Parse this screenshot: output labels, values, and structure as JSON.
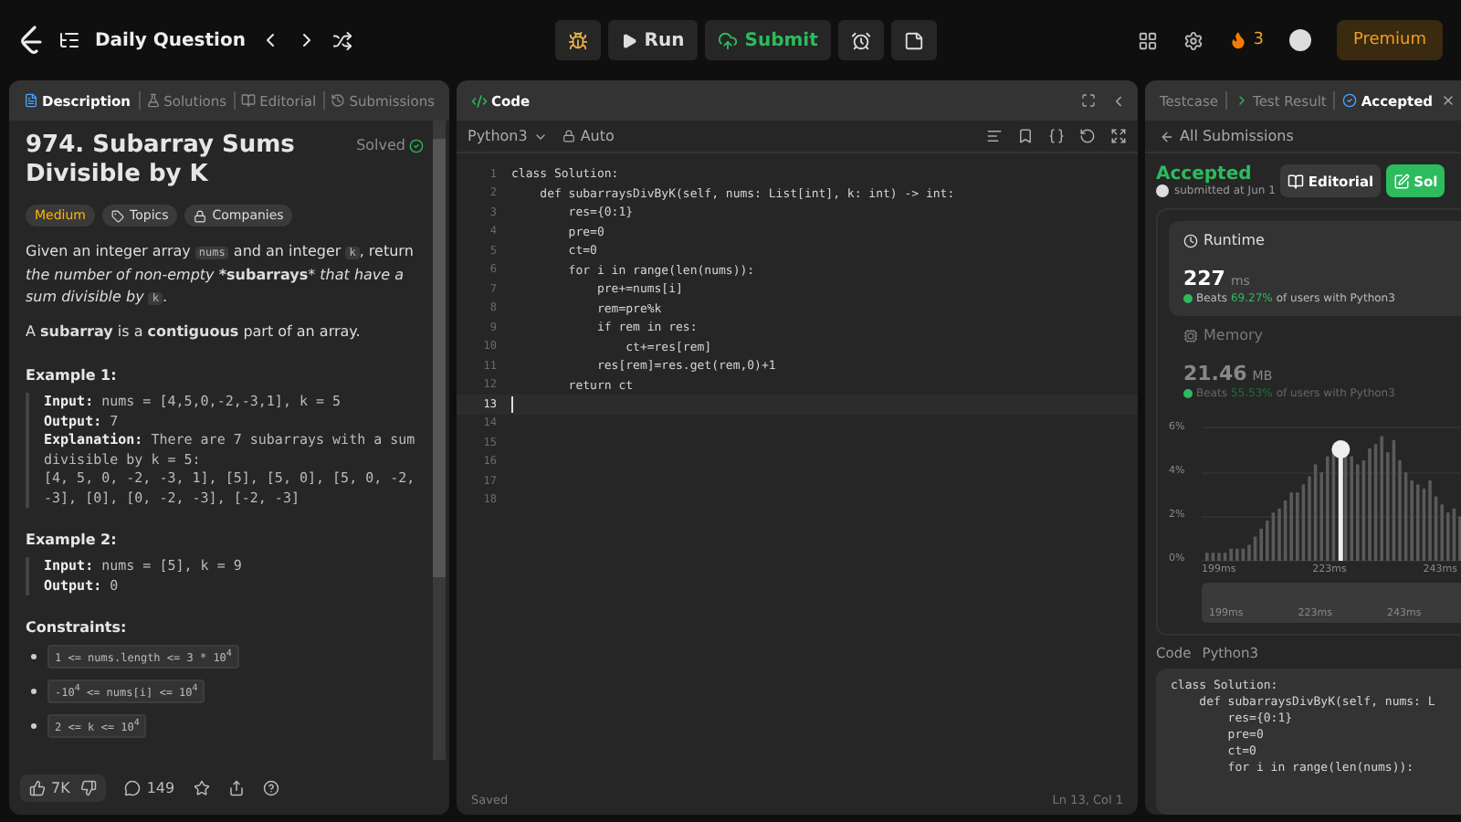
{
  "top_bar": {
    "title": "Daily Question",
    "run": "Run",
    "submit": "Submit",
    "streak": "3",
    "premium": "Premium"
  },
  "description_panel": {
    "tabs": [
      {
        "label": "Description",
        "selected": true
      },
      {
        "label": "Solutions",
        "selected": false
      },
      {
        "label": "Editorial",
        "selected": false
      },
      {
        "label": "Submissions",
        "selected": false
      }
    ],
    "title": "974. Subarray Sums Divisible by K",
    "status": "Solved",
    "difficulty": "Medium",
    "tags": [
      "Topics",
      "Companies"
    ],
    "paragraphs": [
      [
        {
          "kind": "text",
          "text": "Given an integer array "
        },
        {
          "kind": "code",
          "text": "nums"
        },
        {
          "kind": "text",
          "text": " and an integer "
        },
        {
          "kind": "code",
          "text": "k"
        },
        {
          "kind": "text",
          "text": ", return *the number of non-empty* ***subarrays*** *that have a sum divisible by* "
        },
        {
          "kind": "code",
          "text": "k"
        },
        {
          "kind": "text",
          "text": "."
        }
      ],
      [
        {
          "kind": "text",
          "text": "A **subarray** is a **contiguous** part of an array."
        }
      ]
    ],
    "examples": [
      {
        "title": "Example 1:",
        "lines": [
          "**Input:** nums = [4,5,0,-2,-3,1], k = 5",
          "**Output:** 7",
          "**Explanation:** There are 7 subarrays with a sum divisible by k = 5:",
          "[4, 5, 0, -2, -3, 1], [5], [5, 0], [5, 0, -2, -3], [0], [0, -2, -3], [-2, -3]"
        ]
      },
      {
        "title": "Example 2:",
        "lines": [
          "**Input:** nums = [5], k = 9",
          "**Output:** 0"
        ]
      }
    ],
    "constraints_title": "Constraints:",
    "constraints": [
      "1 <= nums.length <= 3 * 10$^{4}$",
      "-10$^{4}$ <= nums[i] <= 10$^{4}$",
      "2 <= k <= 10$^{4}$"
    ],
    "footer": {
      "likes": "7K",
      "comments": "149"
    }
  },
  "code_panel": {
    "title": "Code",
    "language": "Python3",
    "mode": "Auto",
    "lines": [
      {
        "number": "1",
        "code": "class Solution:",
        "cursor": false
      },
      {
        "number": "2",
        "code": "    def subarraysDivByK(self, nums: List[int], k: int) -> int:",
        "cursor": false
      },
      {
        "number": "3",
        "code": "        res={0:1}",
        "cursor": false
      },
      {
        "number": "4",
        "code": "        pre=0",
        "cursor": false
      },
      {
        "number": "5",
        "code": "        ct=0",
        "cursor": false
      },
      {
        "number": "6",
        "code": "        for i in range(len(nums)):",
        "cursor": false
      },
      {
        "number": "7",
        "code": "            pre+=nums[i]",
        "cursor": false
      },
      {
        "number": "8",
        "code": "            rem=pre%k",
        "cursor": false
      },
      {
        "number": "9",
        "code": "            if rem in res:",
        "cursor": false
      },
      {
        "number": "10",
        "code": "                ct+=res[rem]",
        "cursor": false
      },
      {
        "number": "11",
        "code": "            res[rem]=res.get(rem,0)+1",
        "cursor": false
      },
      {
        "number": "12",
        "code": "        return ct",
        "cursor": false
      },
      {
        "number": "13",
        "cursor": true
      },
      {
        "number": "14",
        "cursor": false
      },
      {
        "number": "15",
        "cursor": false
      },
      {
        "number": "16",
        "cursor": false
      },
      {
        "number": "17",
        "cursor": false
      },
      {
        "number": "18",
        "cursor": false
      }
    ],
    "status": "Saved",
    "position": "Ln 13, Col 1"
  },
  "result_panel": {
    "tabs": [
      {
        "label": "Testcase",
        "selected": false
      },
      {
        "label": "Test Result",
        "selected": false
      },
      {
        "label": "Accepted",
        "selected": true
      }
    ],
    "back": "All Submissions",
    "verdict": "Accepted",
    "submitted": "submitted at Jun 1",
    "editorial": "Editorial",
    "solution": "Sol",
    "runtime": {
      "label": "Runtime",
      "value": "227",
      "unit": "ms",
      "beats_prefix": "Beats",
      "percent": "69.27%",
      "beats_suffix": "of users with Python3"
    },
    "memory": {
      "label": "Memory",
      "value": "21.46",
      "unit": "MB",
      "beats_prefix": "Beats",
      "percent": "55.53%",
      "beats_suffix": "of users with Python3"
    },
    "y_labels": [
      "6%",
      "4%",
      "2%",
      "0%"
    ],
    "x_labels": [
      "199ms",
      "223ms",
      "243ms"
    ],
    "mini_x_labels": [
      "199ms",
      "223ms",
      "243ms"
    ],
    "code_label": "Code",
    "code_language": "Python3",
    "code_lines": [
      "class Solution:",
      "    def subarraysDivByK(self, nums: L",
      "        res={0:1}",
      "        pre=0",
      "        ct=0",
      "        for i in range(len(nums)):"
    ]
  }
}
